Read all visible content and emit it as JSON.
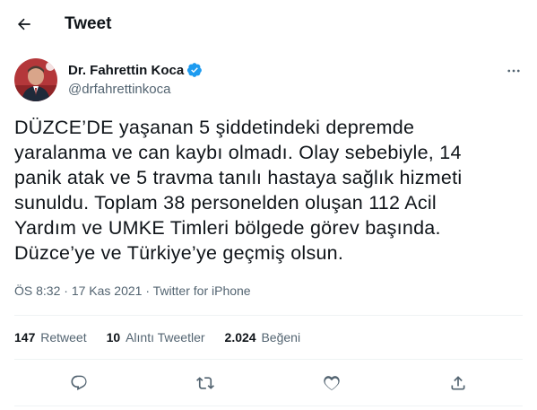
{
  "header": {
    "title": "Tweet",
    "back_icon": "arrow-left-icon"
  },
  "author": {
    "name": "Dr. Fahrettin Koca",
    "handle": "@drfahrettinkoca",
    "verified_color": "#1d9bf0"
  },
  "tweet": {
    "lines": [
      "DÜZCE’DE yaşanan 5 şiddetindeki depremde",
      "yaralanma ve can kaybı olmadı. Olay sebebiyle, 14",
      "panik atak ve 5 travma tanılı hastaya sağlık hizmeti",
      "sunuldu. Toplam 38 personelden oluşan 112 Acil",
      "Yardım ve UMKE Timleri bölgede görev başında.",
      "Düzce’ye ve Türkiye’ye geçmiş olsun."
    ],
    "time": "ÖS 8:32",
    "date": "17 Kas 2021",
    "source": "Twitter for iPhone",
    "separator": "·"
  },
  "stats": {
    "retweets_count": "147",
    "retweets_label": "Retweet",
    "quotes_count": "10",
    "quotes_label": "Alıntı Tweetler",
    "likes_count": "2.024",
    "likes_label": "Beğeni"
  },
  "colors": {
    "text": "#0f1419",
    "secondary": "#536471",
    "divider": "#eff3f4",
    "accent": "#1d9bf0"
  },
  "icons": [
    "arrow-left-icon",
    "verified-badge-icon",
    "more-icon",
    "reply-icon",
    "retweet-icon",
    "like-icon",
    "share-icon"
  ]
}
